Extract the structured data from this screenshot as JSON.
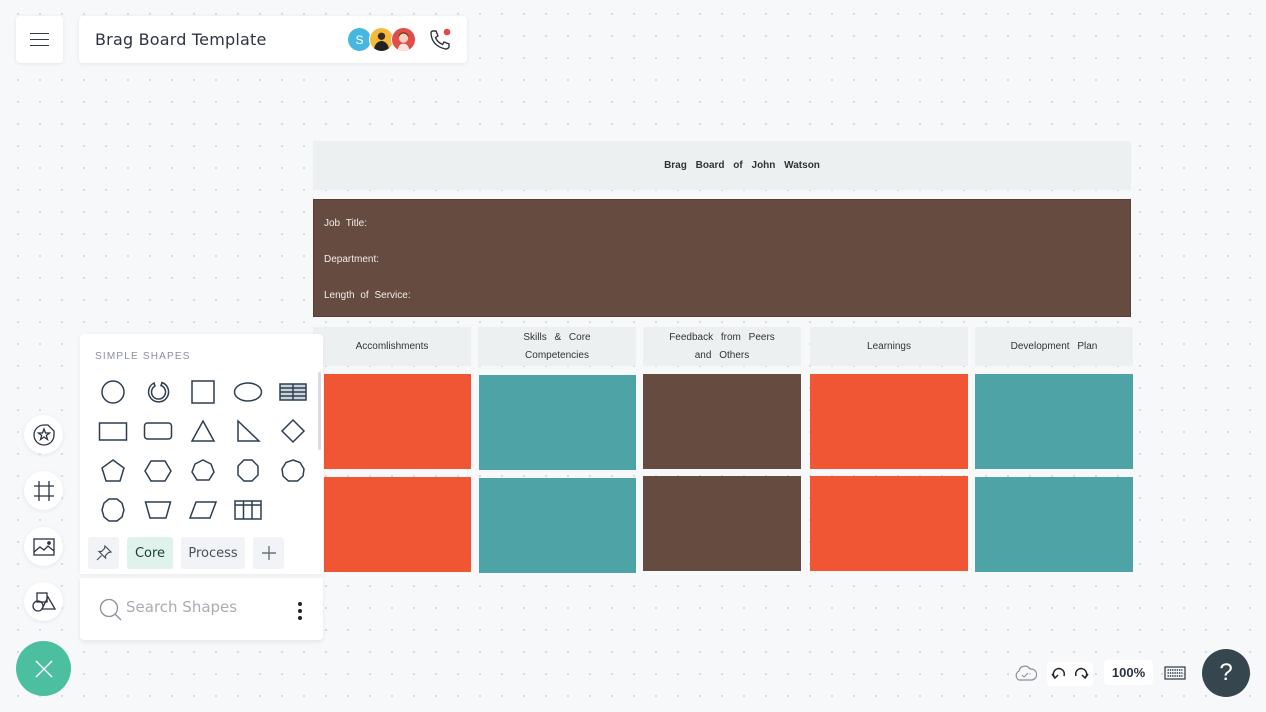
{
  "header": {
    "menu_icon": "hamburger-menu-icon",
    "title": "Brag Board Template",
    "collaborators": [
      {
        "initial": "S",
        "color": "#48b7e0"
      },
      {
        "initial": "",
        "color": "#f6b93b"
      },
      {
        "initial": "",
        "color": "#e24c4b"
      }
    ],
    "call_icon": "phone-icon",
    "call_indicator_color": "#e84545"
  },
  "board": {
    "title": "Brag Board of John Watson",
    "info_fields": [
      "Job Title:",
      "Department:",
      "Length of Service:"
    ],
    "info_color": "#654b40",
    "columns": [
      {
        "header": "Accomlishments",
        "color": "#f05534"
      },
      {
        "header": "Skills & Core Competencies",
        "color": "#4da3a6"
      },
      {
        "header": "Feedback from Peers and Others",
        "color": "#654b40"
      },
      {
        "header": "Learnings",
        "color": "#f05534"
      },
      {
        "header": "Development Plan",
        "color": "#4da3a6"
      }
    ],
    "rows": 2
  },
  "shape_panel": {
    "section_title": "SIMPLE SHAPES",
    "shapes": [
      "circle",
      "arc",
      "square",
      "ellipse",
      "table",
      "rectangle",
      "rounded-rectangle",
      "triangle",
      "right-triangle",
      "diamond",
      "pentagon",
      "hexagon",
      "heptagon",
      "octagon",
      "nonagon",
      "decagon",
      "trapezoid",
      "parallelogram",
      "grid-table"
    ],
    "tabs": [
      {
        "label": "",
        "icon": "pin-icon"
      },
      {
        "label": "Core",
        "active": true
      },
      {
        "label": "Process"
      },
      {
        "label": "",
        "icon": "plus-icon"
      }
    ],
    "search_placeholder": "Search Shapes",
    "more_icon": "more-vertical-icon"
  },
  "left_toolbar": {
    "tools": [
      "sticker-icon",
      "frame-icon",
      "image-icon",
      "shapes-icon"
    ],
    "fab_icon": "close-icon",
    "fab_color": "#4dbfa1"
  },
  "bottom_bar": {
    "save_status_icon": "cloud-saved-icon",
    "undo_icon": "undo-icon",
    "redo_icon": "redo-icon",
    "zoom_level": "100%",
    "keyboard_icon": "keyboard-icon",
    "help_label": "?"
  }
}
